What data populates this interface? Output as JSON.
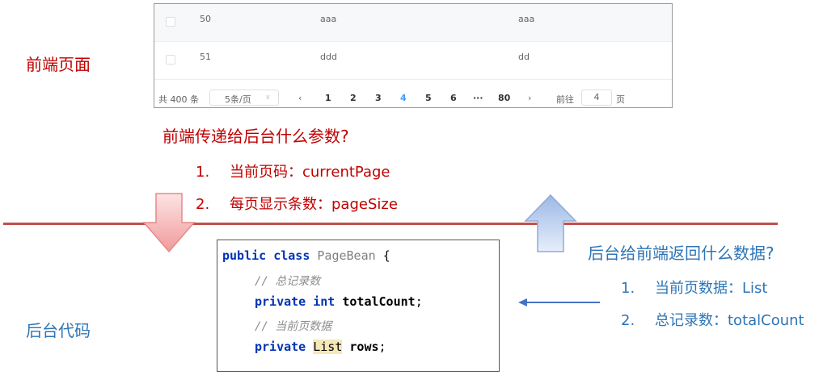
{
  "frontend_label": "前端页面",
  "backend_label": "后台代码",
  "table": {
    "rows": [
      {
        "id": "50",
        "col2": "aaa",
        "col3": "aaa"
      },
      {
        "id": "51",
        "col2": "ddd",
        "col3": "dd"
      }
    ],
    "pagination": {
      "total": "共 400 条",
      "page_size": "5条/页",
      "prev": "‹",
      "pages": [
        "1",
        "2",
        "3",
        "4",
        "5",
        "6",
        "···",
        "80"
      ],
      "current_page": "4",
      "next": "›",
      "goto_label": "前往",
      "goto_value": "4",
      "page_unit": "页"
    }
  },
  "question_frontend": {
    "title": "前端传递给后台什么参数?",
    "items": [
      {
        "num": "1.",
        "text": "当前页码：currentPage"
      },
      {
        "num": "2.",
        "text": "每页显示条数：pageSize"
      }
    ]
  },
  "question_backend": {
    "title": "后台给前端返回什么数据?",
    "items": [
      {
        "num": "1.",
        "text": "当前页数据：List"
      },
      {
        "num": "2.",
        "text": "总记录数：totalCount"
      }
    ]
  },
  "code": {
    "kw_public": "public",
    "kw_class": "class",
    "class_name": "PageBean",
    "brace": "{",
    "comment1": "// 总记录数",
    "kw_private": "private",
    "kw_int": "int",
    "field1": "totalCount",
    "semicolon": ";",
    "comment2": "// 当前页数据",
    "type_list": "List",
    "field2": "rows"
  },
  "colors": {
    "red": "#c00000",
    "blue": "#2e75b6",
    "divider": "#c0504d",
    "arrow_down": "#f4a6a6",
    "arrow_up": "#b4c7e7"
  }
}
